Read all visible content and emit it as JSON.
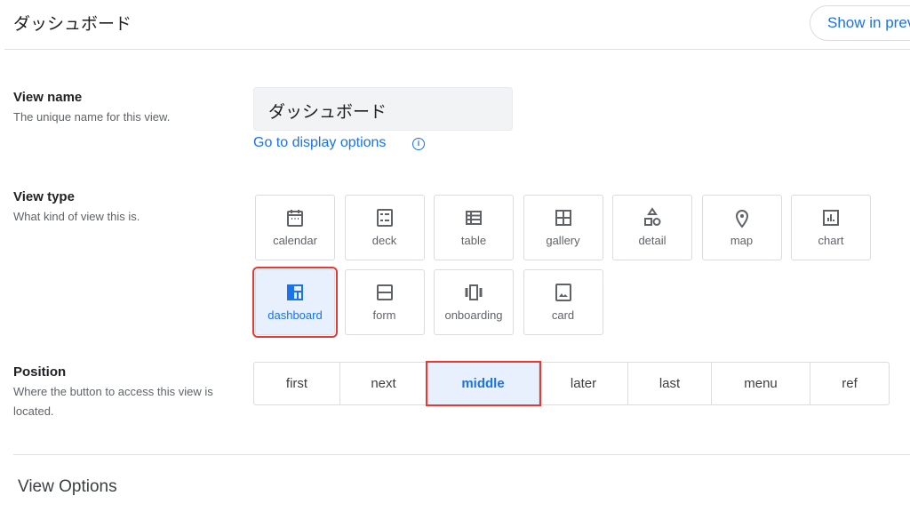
{
  "header": {
    "title": "ダッシュボード",
    "preview_button": "Show in preview"
  },
  "view_name": {
    "label": "View name",
    "description": "The unique name for this view.",
    "value": "ダッシュボード",
    "link": "Go to display options",
    "info_icon": "info-icon"
  },
  "view_type": {
    "label": "View type",
    "description": "What kind of view this is.",
    "selected": "dashboard",
    "options": [
      {
        "label": "calendar",
        "icon": "calendar-icon"
      },
      {
        "label": "deck",
        "icon": "deck-icon"
      },
      {
        "label": "table",
        "icon": "table-icon"
      },
      {
        "label": "gallery",
        "icon": "gallery-icon"
      },
      {
        "label": "detail",
        "icon": "detail-icon"
      },
      {
        "label": "map",
        "icon": "map-pin-icon"
      },
      {
        "label": "chart",
        "icon": "chart-icon"
      },
      {
        "label": "dashboard",
        "icon": "dashboard-icon"
      },
      {
        "label": "form",
        "icon": "form-icon"
      },
      {
        "label": "onboarding",
        "icon": "onboarding-icon"
      },
      {
        "label": "card",
        "icon": "card-icon"
      }
    ]
  },
  "position": {
    "label": "Position",
    "description": "Where the button to access this view is located.",
    "selected": "middle",
    "options": [
      "first",
      "next",
      "middle",
      "later",
      "last",
      "menu",
      "ref"
    ]
  },
  "view_options": {
    "label": "View Options"
  },
  "colors": {
    "accent": "#1a73e8",
    "highlight": "#e53935",
    "selected_bg": "#e8f0fe"
  }
}
